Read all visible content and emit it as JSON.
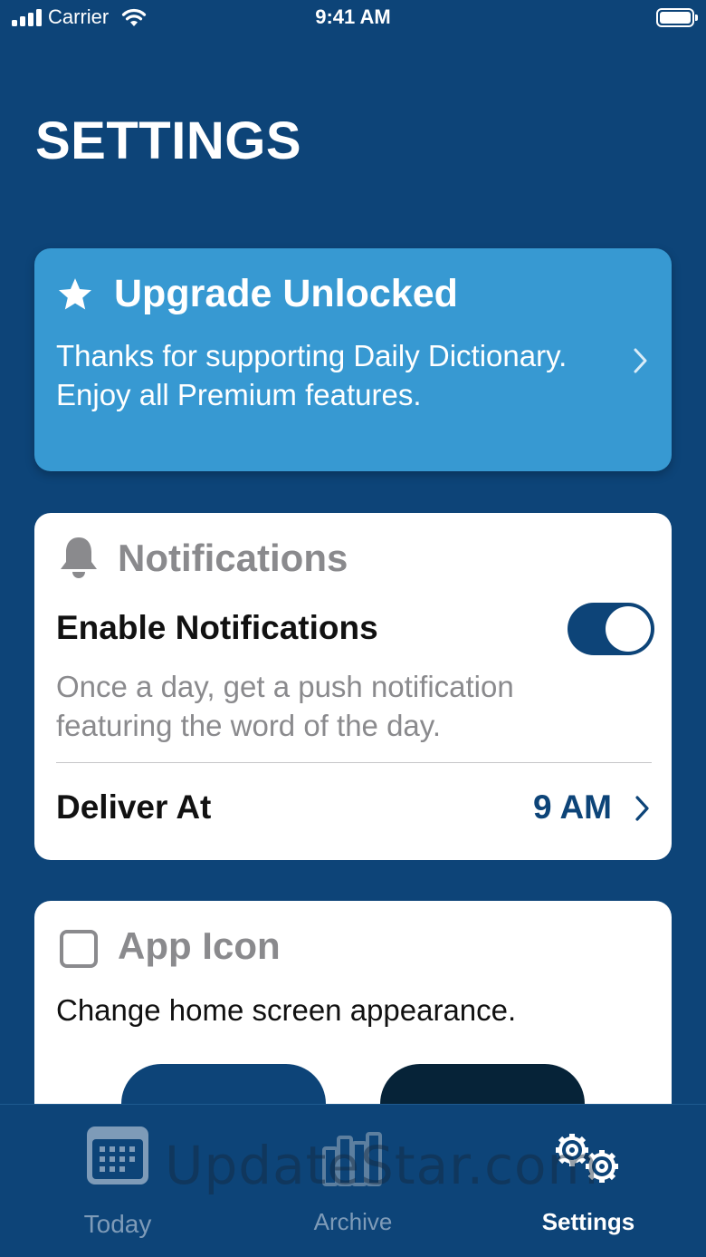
{
  "status_bar": {
    "carrier": "Carrier",
    "time": "9:41 AM"
  },
  "page": {
    "title": "SETTINGS"
  },
  "upgrade": {
    "title": "Upgrade Unlocked",
    "body": "Thanks for supporting Daily Dictionary. Enjoy all Premium features."
  },
  "notifications": {
    "title": "Notifications",
    "enable_label": "Enable Notifications",
    "enabled": true,
    "description": "Once a day, get a push notification featuring the word of the day.",
    "deliver_label": "Deliver At",
    "deliver_value": "9 AM"
  },
  "app_icon": {
    "title": "App Icon",
    "description": "Change home screen appearance."
  },
  "tabs": [
    {
      "label": "Today",
      "icon": "calendar-icon",
      "active": false
    },
    {
      "label": "Archive",
      "icon": "books-icon",
      "active": false
    },
    {
      "label": "Settings",
      "icon": "gears-icon",
      "active": true
    }
  ],
  "watermark": "UpdateStar.com",
  "colors": {
    "background": "#0d4478",
    "upgrade_card": "#3799d2",
    "muted": "#8a8a8d",
    "toggle_on": "#0d4478"
  }
}
